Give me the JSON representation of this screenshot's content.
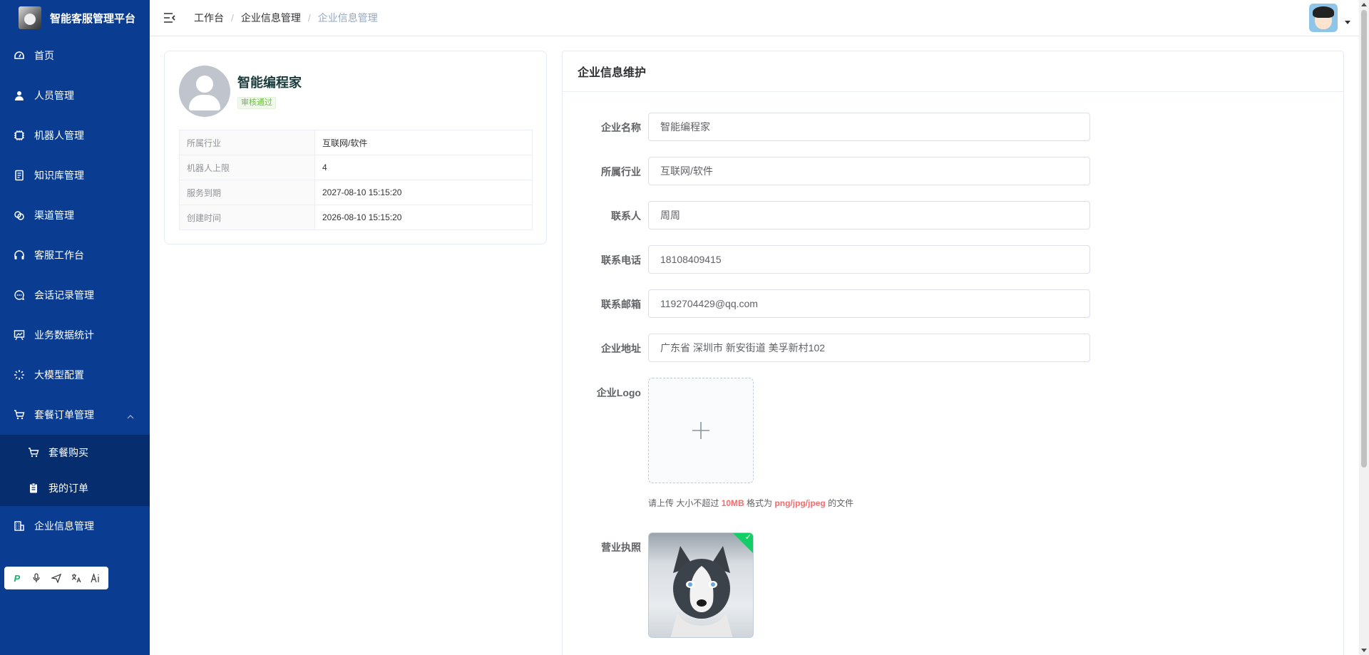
{
  "app": {
    "title": "智能客服管理平台"
  },
  "sidebar": {
    "items": [
      {
        "label": "首页",
        "icon": "dashboard-icon"
      },
      {
        "label": "人员管理",
        "icon": "user-icon"
      },
      {
        "label": "机器人管理",
        "icon": "cpu-icon"
      },
      {
        "label": "知识库管理",
        "icon": "book-icon"
      },
      {
        "label": "渠道管理",
        "icon": "link-icon"
      },
      {
        "label": "客服工作台",
        "icon": "headset-icon"
      },
      {
        "label": "会话记录管理",
        "icon": "chat-icon"
      },
      {
        "label": "业务数据统计",
        "icon": "chart-board-icon"
      },
      {
        "label": "大模型配置",
        "icon": "loading-icon"
      },
      {
        "label": "套餐订单管理",
        "icon": "cart-icon"
      },
      {
        "label": "企业信息管理",
        "icon": "office-building-icon"
      }
    ],
    "submenu": [
      {
        "label": "套餐购买",
        "icon": "cart-icon"
      },
      {
        "label": "我的订单",
        "icon": "clipboard-icon"
      }
    ]
  },
  "header": {
    "breadcrumb": [
      "工作台",
      "企业信息管理",
      "企业信息管理"
    ],
    "separator": "/"
  },
  "profile": {
    "name": "智能编程家",
    "status": "审核通过",
    "rows": [
      {
        "key": "所属行业",
        "value": "互联网/软件"
      },
      {
        "key": "机器人上限",
        "value": "4"
      },
      {
        "key": "服务到期",
        "value": "2027-08-10 15:15:20"
      },
      {
        "key": "创建时间",
        "value": "2026-08-10 15:15:20"
      }
    ]
  },
  "form": {
    "title": "企业信息维护",
    "fields": {
      "name": {
        "label": "企业名称",
        "value": "智能编程家"
      },
      "industry": {
        "label": "所属行业",
        "value": "互联网/软件"
      },
      "contact": {
        "label": "联系人",
        "value": "周周"
      },
      "phone": {
        "label": "联系电话",
        "value": "18108409415"
      },
      "email": {
        "label": "联系邮箱",
        "value": "1192704429@qq.com"
      },
      "address": {
        "label": "企业地址",
        "value": "广东省 深圳市 新安街道 美孚新村102"
      }
    },
    "logo": {
      "label": "企业Logo",
      "tip_prefix": "请上传 大小不超过",
      "tip_size": "10MB",
      "tip_mid": "格式为",
      "tip_format": "png/jpg/jpeg",
      "tip_suffix": "的文件"
    },
    "license": {
      "label": "营业执照"
    }
  },
  "tools": [
    "p-logo-icon",
    "microphone-icon",
    "send-icon",
    "translate-icon",
    "ai-text-icon"
  ],
  "colors": {
    "sidebar": "#0a3d91",
    "submenu": "#062e6f",
    "success": "#67c23a",
    "accent_red": "#f56c6c"
  }
}
